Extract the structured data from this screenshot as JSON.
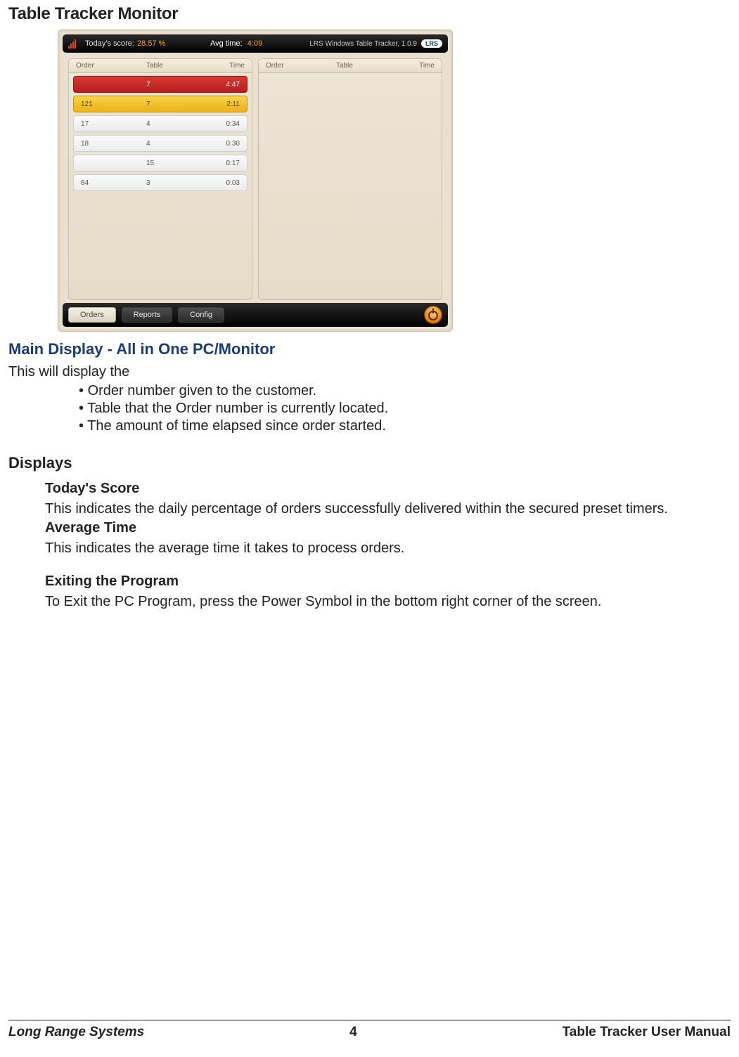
{
  "page": {
    "title": "Table Tracker Monitor",
    "footer_left": "Long Range Systems",
    "footer_center": "4",
    "footer_right": "Table Tracker User Manual"
  },
  "screenshot": {
    "topbar": {
      "score_label": "Today's score:",
      "score_value": "28.57 %",
      "avg_label": "Avg time:",
      "avg_value": "4:09",
      "product": "LRS Windows Table Tracker, 1.0.9",
      "logo_text": "LRS"
    },
    "columns": {
      "headers": [
        "Order",
        "Table",
        "Time"
      ]
    },
    "left_rows": [
      {
        "order": "",
        "table": "7",
        "time": "4:47",
        "style": "red"
      },
      {
        "order": "121",
        "table": "7",
        "time": "2:11",
        "style": "yellow"
      },
      {
        "order": "17",
        "table": "4",
        "time": "0:34",
        "style": "plain"
      },
      {
        "order": "18",
        "table": "4",
        "time": "0:30",
        "style": "plain"
      },
      {
        "order": "",
        "table": "15",
        "time": "0:17",
        "style": "plain"
      },
      {
        "order": "84",
        "table": "3",
        "time": "0:03",
        "style": "plain"
      }
    ],
    "bottombar": {
      "orders": "Orders",
      "reports": "Reports",
      "config": "Config"
    }
  },
  "sections": {
    "main_display_heading": "Main Display - All in One PC/Monitor",
    "main_display_intro": "This will display the",
    "main_display_bullets": [
      "Order number given to the customer.",
      "Table that the Order number is currently located.",
      "The amount of time elapsed since order started."
    ],
    "displays_heading": "Displays",
    "todays_score_heading": "Today's  Score",
    "todays_score_body": "This indicates the daily percentage of orders successfully delivered within the secured preset timers.",
    "average_time_heading": "Average Time",
    "average_time_body": "This indicates the average time it takes to process orders.",
    "exiting_heading": "Exiting the Program",
    "exiting_body": "To Exit the PC Program, press the Power Symbol in the bottom right corner of the screen."
  }
}
